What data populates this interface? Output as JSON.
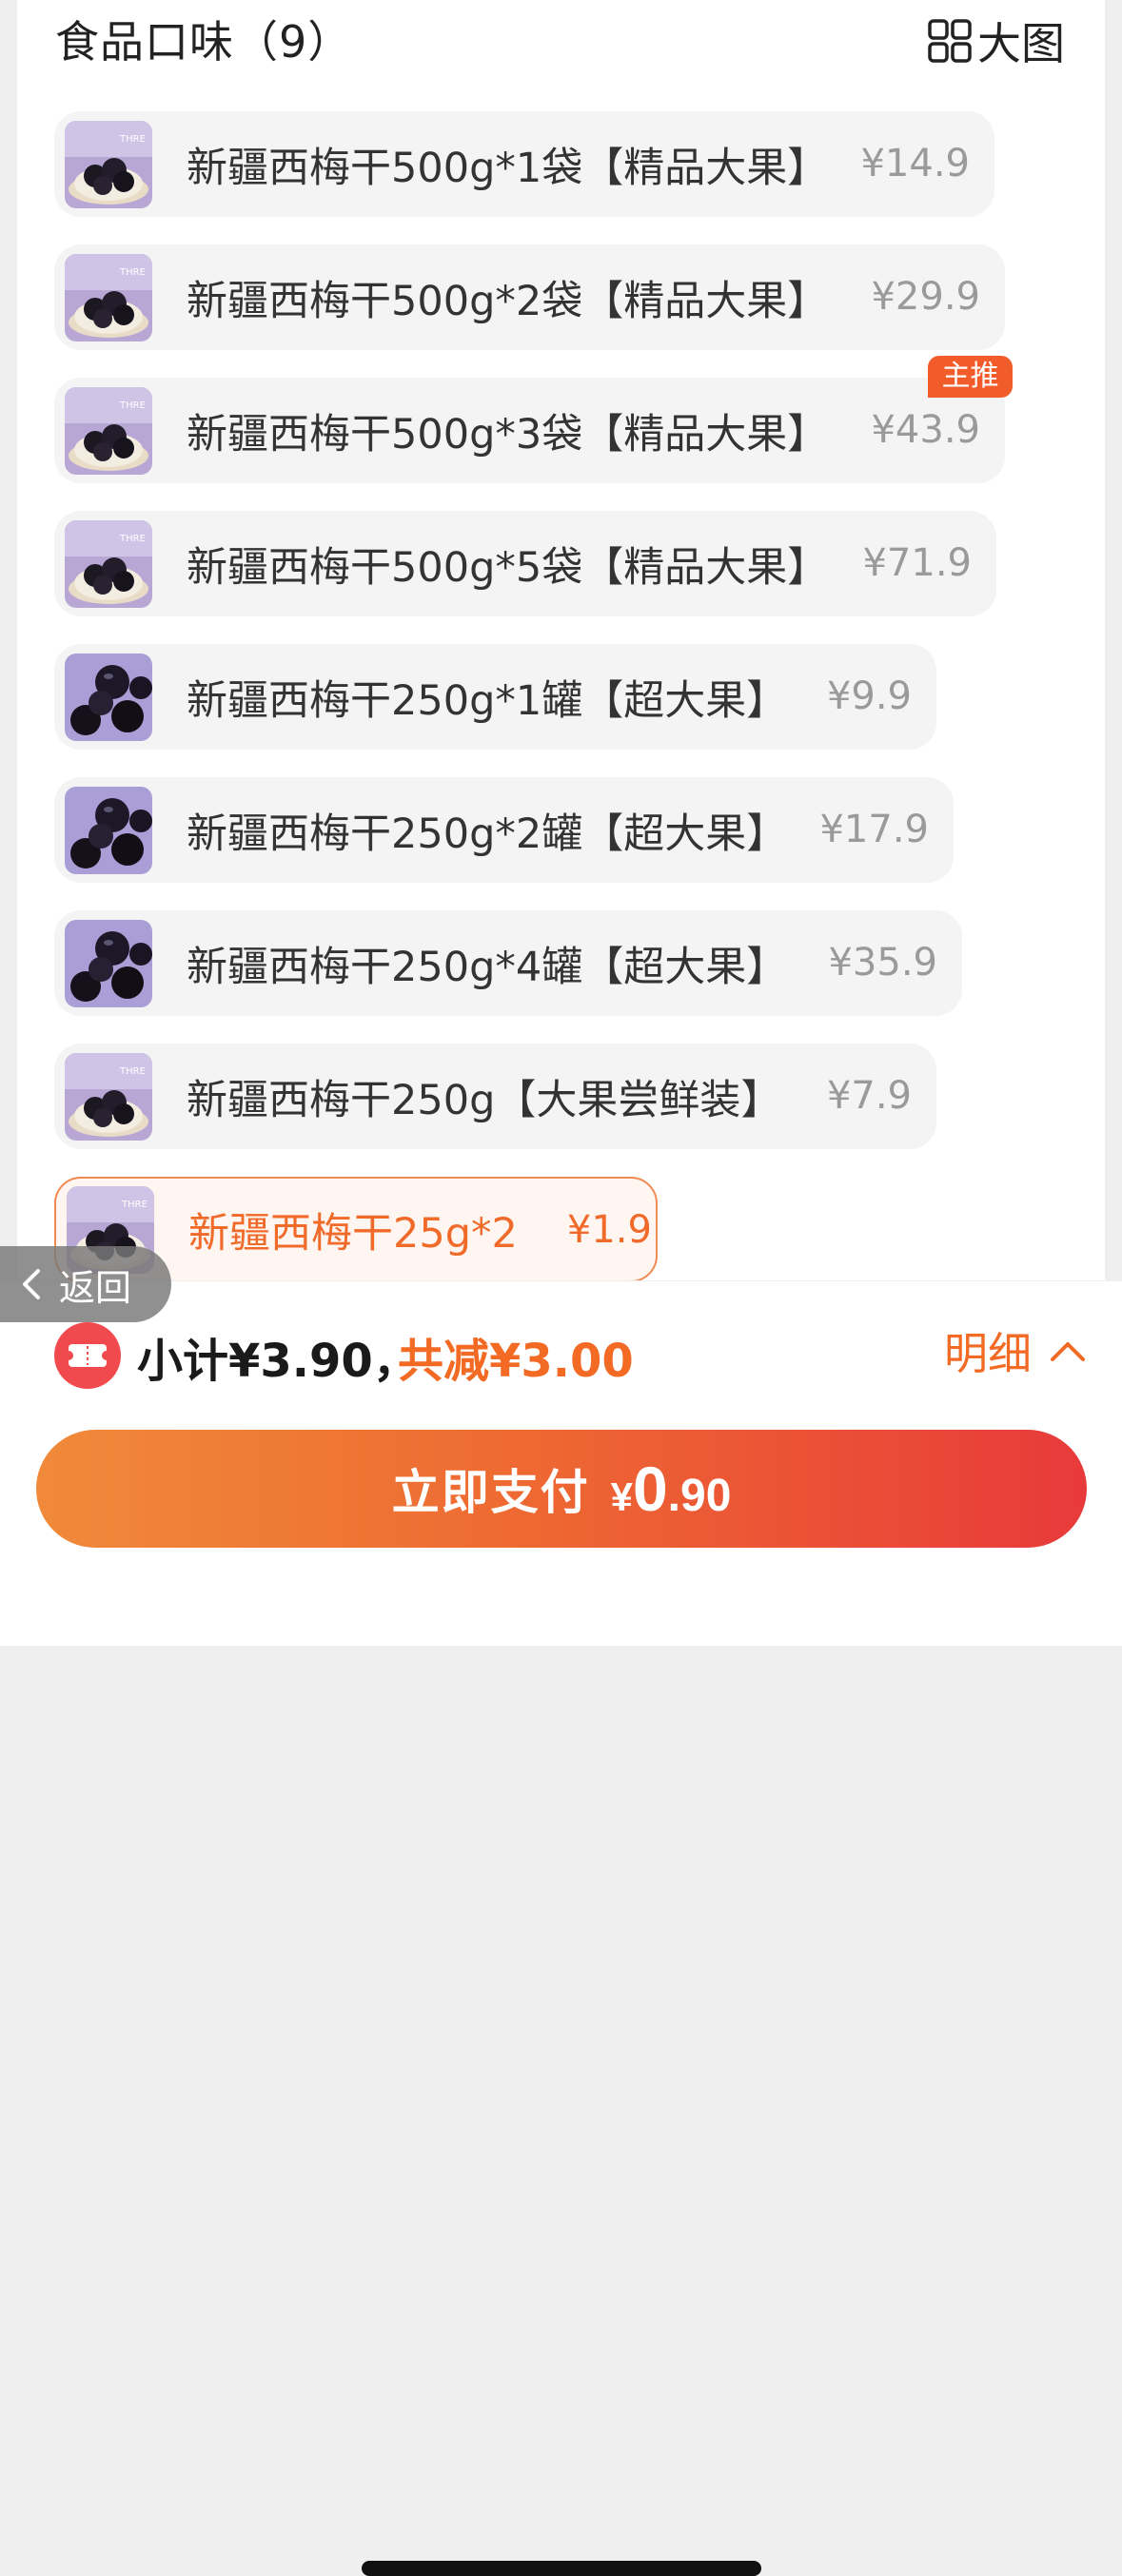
{
  "header": {
    "title": "食品口味（9）",
    "bigview_label": "大图"
  },
  "options": [
    {
      "name": "新疆西梅干500g*1袋【精品大果】",
      "price": "¥14.9",
      "image": "prune-bag-thumbnail"
    },
    {
      "name": "新疆西梅干500g*2袋【精品大果】",
      "price": "¥29.9",
      "image": "prune-bag-thumbnail"
    },
    {
      "name": "新疆西梅干500g*3袋【精品大果】",
      "price": "¥43.9",
      "image": "prune-bag-thumbnail",
      "badge": "主推"
    },
    {
      "name": "新疆西梅干500g*5袋【精品大果】",
      "price": "¥71.9",
      "image": "prune-bag-thumbnail"
    },
    {
      "name": "新疆西梅干250g*1罐【超大果】",
      "price": "¥9.9",
      "image": "prune-closeup-thumbnail"
    },
    {
      "name": "新疆西梅干250g*2罐【超大果】",
      "price": "¥17.9",
      "image": "prune-closeup-thumbnail"
    },
    {
      "name": "新疆西梅干250g*4罐【超大果】",
      "price": "¥35.9",
      "image": "prune-closeup-thumbnail"
    },
    {
      "name": "新疆西梅干250g【大果尝鲜装】",
      "price": "¥7.9",
      "image": "prune-bag-thumbnail"
    },
    {
      "name": "新疆西梅干25g*2",
      "price": "¥1.9",
      "image": "prune-bag-thumbnail",
      "selected": true
    }
  ],
  "back_button": {
    "label": "返回"
  },
  "summary": {
    "subtotal": "小计¥3.90，",
    "discount": "共减¥3.00",
    "detail_label": "明细"
  },
  "pay_button": {
    "label": "立即支付",
    "currency": "¥",
    "amount_int": "0",
    "amount_dec": ".90"
  },
  "colors": {
    "accent": "#f26a24",
    "badge": "#f25c2a",
    "pay_gradient_start": "#f08a3a",
    "pay_gradient_end": "#e83a3a"
  }
}
